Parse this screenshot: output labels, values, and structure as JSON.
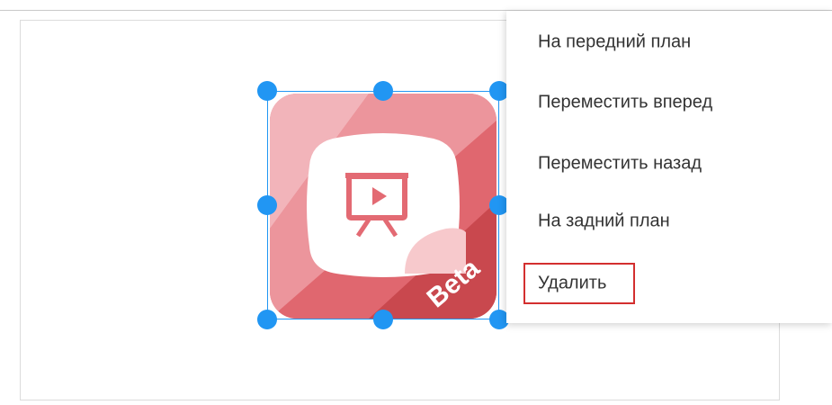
{
  "context_menu": {
    "items": [
      {
        "label": "На передний план"
      },
      {
        "label": "Переместить вперед"
      },
      {
        "label": "Переместить назад"
      },
      {
        "label": "На задний план"
      },
      {
        "label": "Удалить"
      }
    ],
    "highlighted_item": "Удалить"
  },
  "selected_object": {
    "badge_text": "Beta",
    "icon": "presentation-screen-play-icon"
  },
  "colors": {
    "selection": "#2196f3",
    "highlight": "#d32f2f",
    "icon_bg": "#e67a82",
    "badge": "#c9484e"
  }
}
